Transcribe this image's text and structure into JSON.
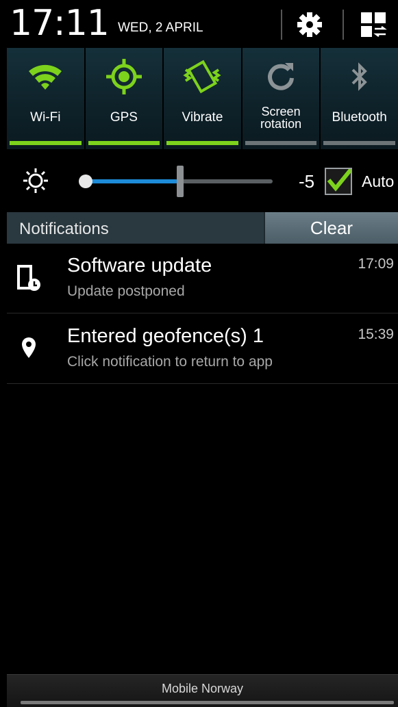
{
  "header": {
    "time": "17:11",
    "date": "WED, 2 APRIL",
    "settings_icon": "gear-icon",
    "grid_icon": "quick-panel-grid-icon"
  },
  "toggles": [
    {
      "label": "Wi-Fi",
      "icon": "wifi-icon",
      "on": true
    },
    {
      "label": "GPS",
      "icon": "gps-icon",
      "on": true
    },
    {
      "label": "Vibrate",
      "icon": "vibrate-icon",
      "on": true
    },
    {
      "label_line1": "Screen",
      "label_line2": "rotation",
      "icon": "rotate-icon",
      "on": false
    },
    {
      "label": "Bluetooth",
      "icon": "bluetooth-icon",
      "on": false
    }
  ],
  "brightness": {
    "value_label": "-5",
    "level": 0.5,
    "auto_checked": true,
    "auto_label": "Auto"
  },
  "notifications": {
    "title": "Notifications",
    "clear_label": "Clear",
    "items": [
      {
        "title": "Software update",
        "subtitle": "Update postponed",
        "time": "17:09",
        "icon": "device-clock-icon"
      },
      {
        "title": "Entered geofence(s) 1",
        "subtitle": "Click notification to return to app",
        "time": "15:39",
        "icon": "location-pin-icon"
      }
    ]
  },
  "footer": {
    "carrier": "Mobile Norway"
  },
  "colors": {
    "accent_on": "#7dd21c",
    "slider_fill": "#1e8bd8",
    "panel_bg": "#0e2129"
  }
}
